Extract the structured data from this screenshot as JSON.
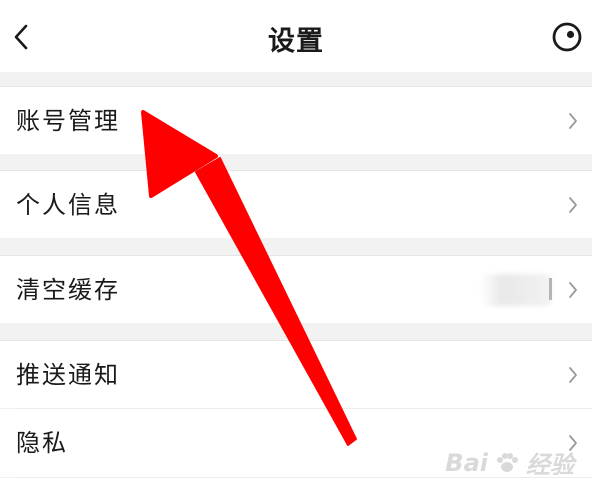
{
  "header": {
    "title": "设置",
    "back_icon": "chevron-left-icon",
    "right_icon": "camera-lens-icon"
  },
  "settings": [
    {
      "label": "账号管理",
      "icon": "chevron-right-icon"
    },
    {
      "label": "个人信息",
      "icon": "chevron-right-icon"
    },
    {
      "label": "清空缓存",
      "icon": "chevron-right-icon"
    },
    {
      "label": "推送通知",
      "icon": "chevron-right-icon"
    },
    {
      "label": "隐私",
      "icon": "chevron-right-icon"
    }
  ],
  "watermark": {
    "text": "Bai",
    "suffix": "经验"
  },
  "colors": {
    "annotation_arrow": "#ff0000",
    "background": "#f2f2f2",
    "row_background": "#ffffff"
  }
}
